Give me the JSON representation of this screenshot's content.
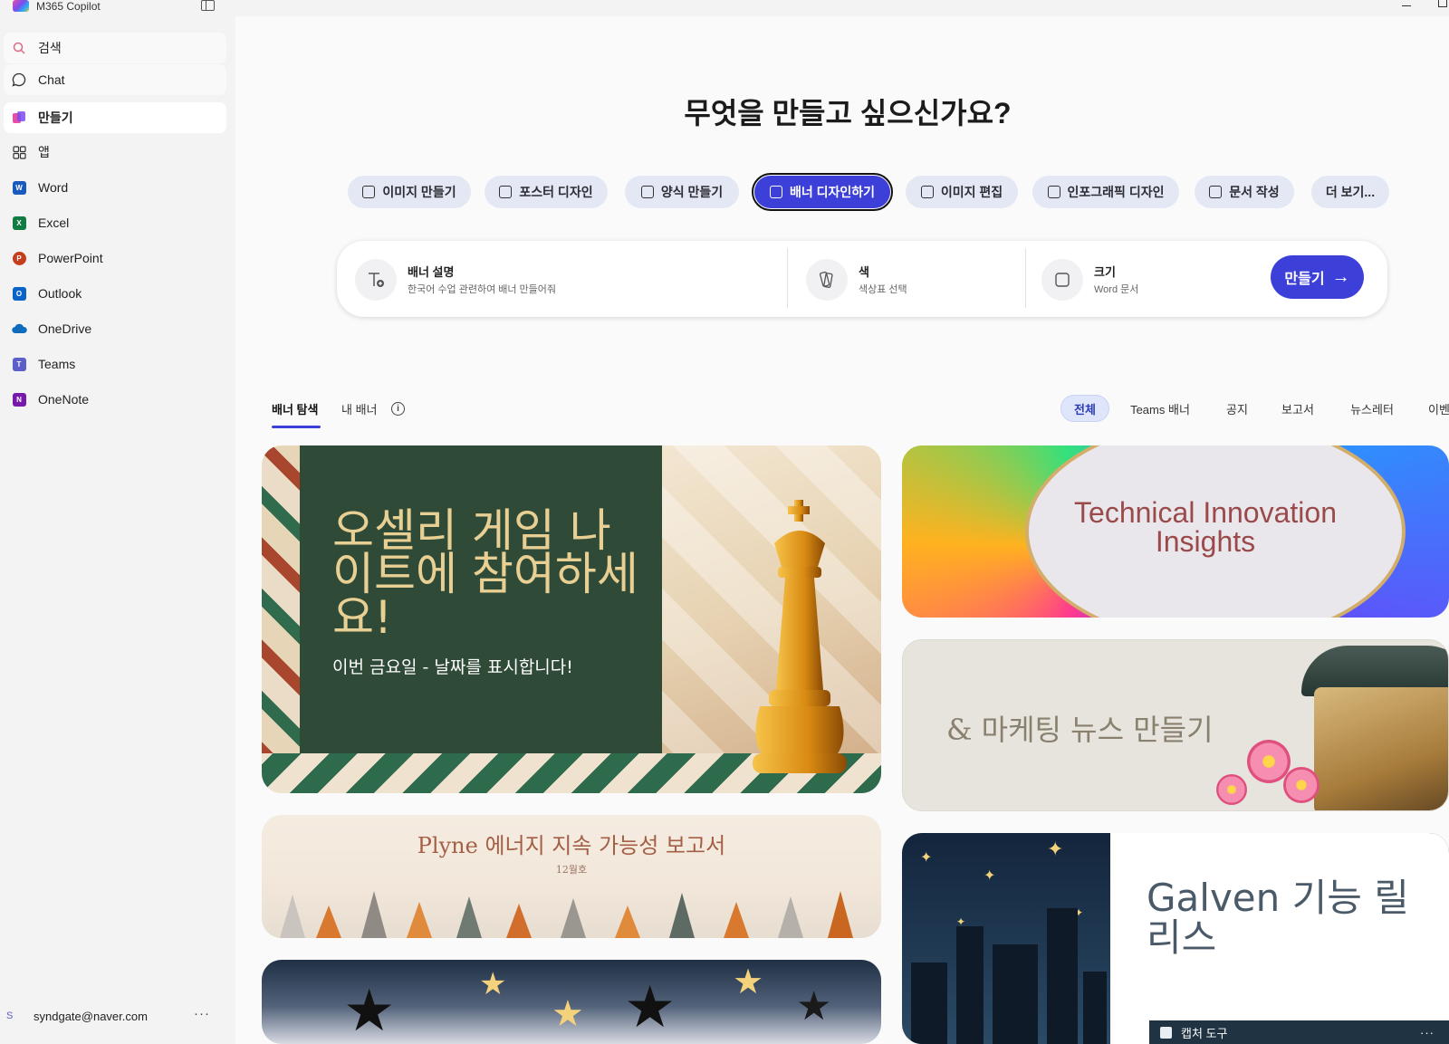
{
  "window": {
    "title": "M365 Copilot"
  },
  "sidebar": {
    "search_label": "검색",
    "items": [
      {
        "label": "Chat",
        "icon": "chat-bubble-icon"
      },
      {
        "label": "만들기",
        "icon": "create-icon",
        "active": true
      },
      {
        "label": "앱",
        "icon": "apps-grid-icon"
      },
      {
        "label": "Word",
        "icon": "word-icon",
        "color": "#185abd"
      },
      {
        "label": "Excel",
        "icon": "excel-icon",
        "color": "#107c41"
      },
      {
        "label": "PowerPoint",
        "icon": "powerpoint-icon",
        "color": "#c43e1c"
      },
      {
        "label": "Outlook",
        "icon": "outlook-icon",
        "color": "#0a64c8"
      },
      {
        "label": "OneDrive",
        "icon": "onedrive-icon",
        "color": "#0f6cbd"
      },
      {
        "label": "Teams",
        "icon": "teams-icon",
        "color": "#5b5fc7"
      },
      {
        "label": "OneNote",
        "icon": "onenote-icon",
        "color": "#7719aa"
      }
    ],
    "user": {
      "initial": "S",
      "email": "syndgate@naver.com",
      "more": "···"
    }
  },
  "main": {
    "heading": "무엇을 만들고 싶으신가요?",
    "chips": [
      {
        "label": "이미지 만들기",
        "icon": "image-icon"
      },
      {
        "label": "포스터 디자인",
        "icon": "poster-icon"
      },
      {
        "label": "양식 만들기",
        "icon": "form-icon"
      },
      {
        "label": "배너 디자인하기",
        "icon": "banner-icon",
        "selected": true
      },
      {
        "label": "이미지 편집",
        "icon": "image-edit-icon"
      },
      {
        "label": "인포그래픽 디자인",
        "icon": "infographic-icon"
      },
      {
        "label": "문서 작성",
        "icon": "word-doc-icon"
      },
      {
        "label": "더 보기...",
        "icon": ""
      }
    ],
    "prompt": {
      "description_label": "배너 설명",
      "description_value": "한국어 수업 관련하여 배너 만들어줘",
      "color_label": "색",
      "color_value": "색상표 선택",
      "size_label": "크기",
      "size_value": "Word 문서",
      "submit_label": "만들기",
      "submit_arrow": "→"
    },
    "tabs": [
      {
        "label": "배너 탐색",
        "active": true
      },
      {
        "label": "내 배너"
      }
    ],
    "info_glyph": "i",
    "filters": [
      {
        "label": "전체",
        "active": true
      },
      {
        "label": "Teams 배너"
      },
      {
        "label": "공지"
      },
      {
        "label": "보고서"
      },
      {
        "label": "뉴스레터"
      },
      {
        "label": "이벤"
      }
    ],
    "cards": {
      "othello": {
        "headline": "오셀리 게임 나이트에 참여하세요!",
        "sub": "이번 금요일 - 날짜를 표시합니다!"
      },
      "tech": {
        "title": "Technical Innovation Insights"
      },
      "marketing": {
        "title": "& 마케팅 뉴스 만들기"
      },
      "plyne": {
        "title": "Plyne 에너지 지속 가능성 보고서",
        "subtitle": "12월호"
      },
      "galven": {
        "title": "Galven 기능 릴리스"
      }
    }
  },
  "taskbar": {
    "capture_label": "캡처 도구",
    "more": "···"
  }
}
